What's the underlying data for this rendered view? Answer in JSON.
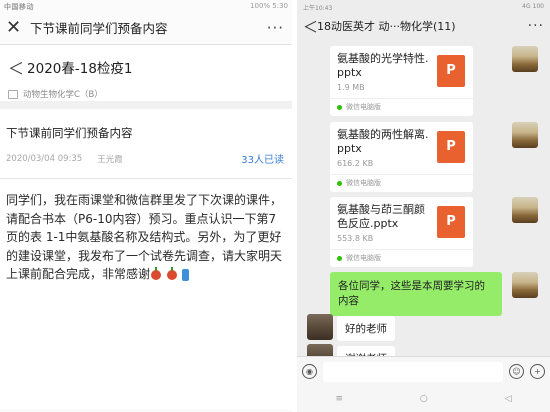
{
  "left": {
    "status": {
      "carrier": "中国移动",
      "right": "100%  5:30"
    },
    "header": {
      "title": "下节课前同学们预备内容"
    },
    "course": {
      "name": "2020春-18检疫1",
      "subject": "动物生物化学C（B）"
    },
    "notice": {
      "title": "下节课前同学们预备内容",
      "date": "2020/03/04 09:35",
      "author": "王光霞",
      "read_count": "33人已读",
      "body": "同学们，我在雨课堂和微信群里发了下次课的课件，请配合书本（P6-10内容）预习。重点认识一下第7页的表 1-1中氨基酸名称及结构式。另外，为了更好的建设课堂，我发布了一个试卷先调查，请大家明天上课前配合完成，非常感谢"
    }
  },
  "right": {
    "status": {
      "time": "上午10:43",
      "icons": "4G  100"
    },
    "header": {
      "title": "18动医英才 动···物化学(11)"
    },
    "files": [
      {
        "name": "氨基酸的光学特性.pptx",
        "size": "1.9 MB",
        "source": "微信电脑版",
        "icon": "P"
      },
      {
        "name": "氨基酸的两性解离.pptx",
        "size": "616.2 KB",
        "source": "微信电脑版",
        "icon": "P"
      },
      {
        "name": "氨基酸与茚三酮颜色反应.pptx",
        "size": "553.8 KB",
        "source": "微信电脑版",
        "icon": "P"
      }
    ],
    "green_message": "各位同学，这些是本周要学习的内容",
    "replies": [
      "好的老师",
      "谢谢老师"
    ],
    "input": {
      "voice_icon": "voice-icon",
      "emoji_icon": "emoji-icon",
      "plus_icon": "plus-icon"
    }
  }
}
